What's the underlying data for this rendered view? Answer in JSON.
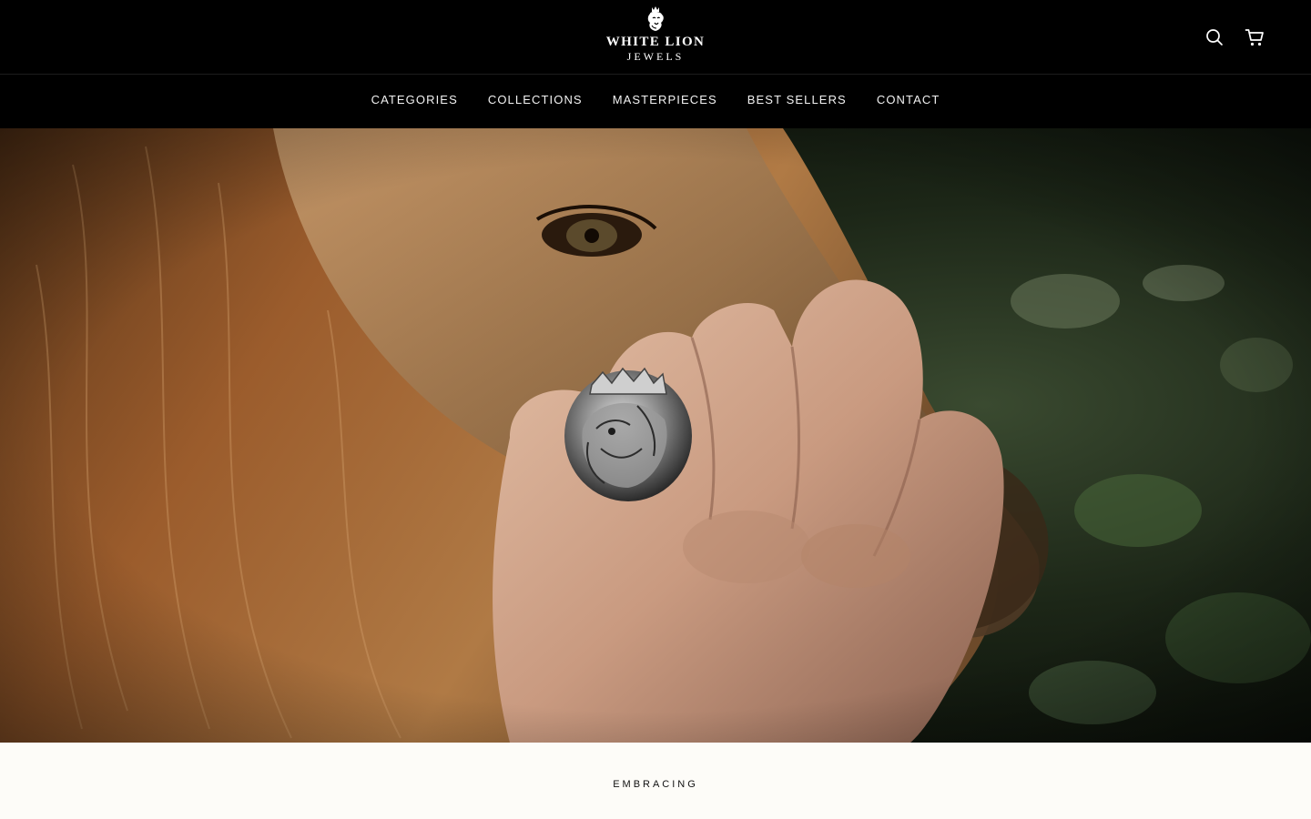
{
  "brand": {
    "name_line1": "WHITE LION",
    "name_line2": "JEWELS",
    "logo_icon": "lion-head-icon"
  },
  "header": {
    "search_icon": "search-icon",
    "cart_icon": "cart-icon"
  },
  "nav": {
    "items": [
      {
        "label": "CATEGORIES"
      },
      {
        "label": "COLLECTIONS"
      },
      {
        "label": "MASTERPIECES"
      },
      {
        "label": "BEST SELLERS"
      },
      {
        "label": "CONTACT"
      }
    ]
  },
  "hero": {
    "image": "hand-with-lion-ring-against-lion-face"
  },
  "intro": {
    "eyebrow": "EMBRACING"
  },
  "colors": {
    "header_bg": "#000000",
    "page_bg": "#fdfcf8",
    "nav_text": "#f2f2f2"
  }
}
